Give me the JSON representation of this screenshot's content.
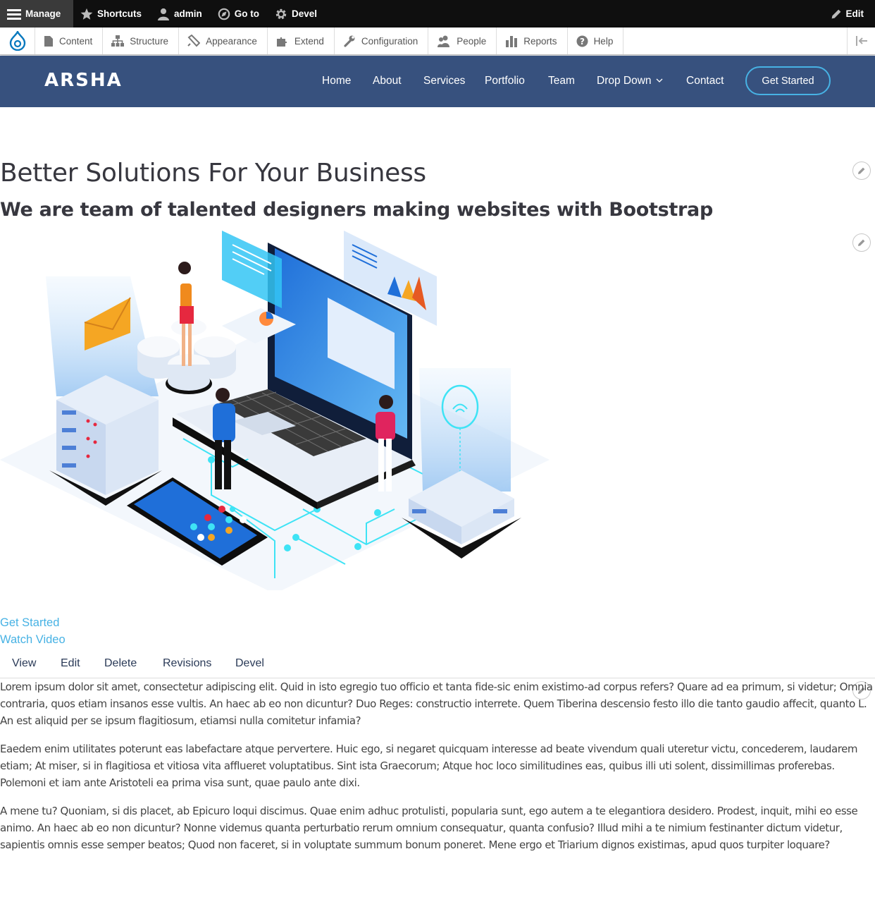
{
  "admin_toolbar": {
    "manage": "Manage",
    "shortcuts": "Shortcuts",
    "user": "admin",
    "goto": "Go to",
    "devel": "Devel",
    "edit": "Edit"
  },
  "admin_tray": {
    "items": [
      "Content",
      "Structure",
      "Appearance",
      "Extend",
      "Configuration",
      "People",
      "Reports",
      "Help"
    ]
  },
  "site": {
    "logo": "ARSHA",
    "nav": [
      "Home",
      "About",
      "Services",
      "Portfolio",
      "Team",
      "Drop Down",
      "Contact"
    ],
    "cta": "Get Started"
  },
  "hero": {
    "title": "Better Solutions For Your Business",
    "subtitle": "We are team of talented designers making websites with Bootstrap",
    "get_started": "Get Started",
    "watch_video": "Watch Video"
  },
  "tabs": [
    "View",
    "Edit",
    "Delete",
    "Revisions",
    "Devel"
  ],
  "body": {
    "p1": "Lorem ipsum dolor sit amet, consectetur adipiscing elit. Quid in isto egregio tuo officio et tanta fide-sic enim existimo-ad corpus refers? Quare ad ea primum, si videtur; Omnia contraria, quos etiam insanos esse vultis. An haec ab eo non dicuntur? Duo Reges: constructio interrete. Quem Tiberina descensio festo illo die tanto gaudio affecit, quanto L. An est aliquid per se ipsum flagitiosum, etiamsi nulla comitetur infamia?",
    "p2": "Eaedem enim utilitates poterunt eas labefactare atque pervertere. Huic ego, si negaret quicquam interesse ad beate vivendum quali uteretur victu, concederem, laudarem etiam; At miser, si in flagitiosa et vitiosa vita afflueret voluptatibus. Sint ista Graecorum; Atque hoc loco similitudines eas, quibus illi uti solent, dissimillimas proferebas. Polemoni et iam ante Aristoteli ea prima visa sunt, quae paulo ante dixi.",
    "p3": "A mene tu? Quoniam, si dis placet, ab Epicuro loqui discimus. Quae enim adhuc protulisti, popularia sunt, ego autem a te elegantiora desidero. Prodest, inquit, mihi eo esse animo. An haec ab eo non dicuntur? Nonne videmus quanta perturbatio rerum omnium consequatur, quanta confusio? Illud mihi a te nimium festinanter dictum videtur, sapientis omnis esse semper beatos; Quod non faceret, si in voluptate summum bonum poneret. Mene ergo et Triarium dignos existimas, apud quos turpiter loquare?"
  },
  "colors": {
    "toolbar": "#0f0f0f",
    "header": "#37517e",
    "accent": "#47b2e4"
  }
}
